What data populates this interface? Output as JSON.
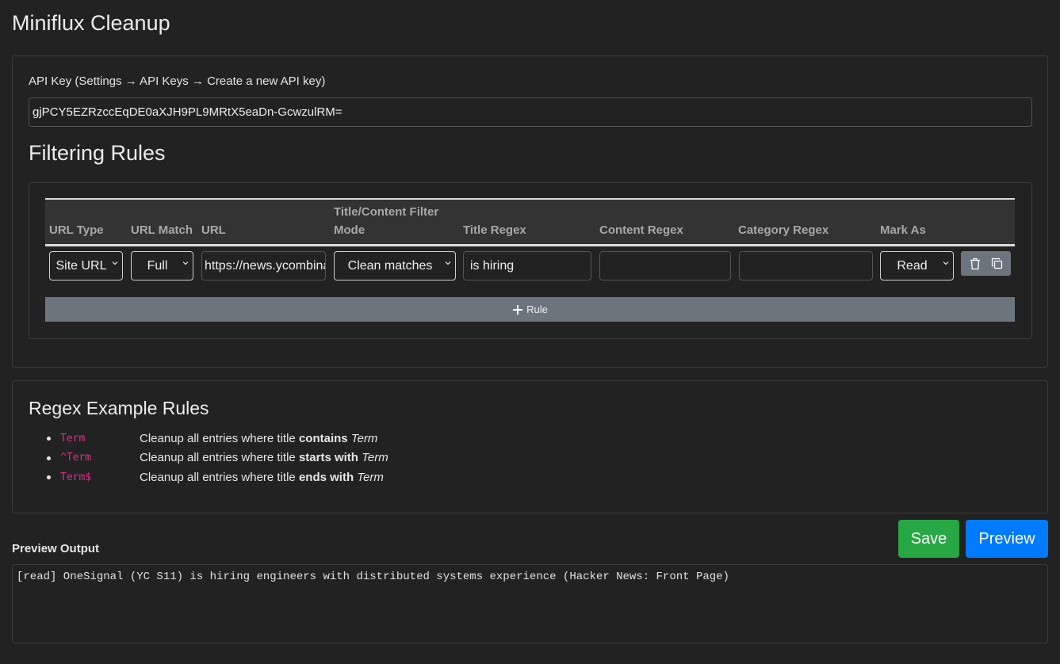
{
  "page": {
    "title": "Miniflux Cleanup"
  },
  "api": {
    "label": "API Key (Settings → API Keys → Create a new API key)",
    "value": "gjPCY5EZRzccEqDE0aXJH9PL9MRtX5eaDn-GcwzulRM="
  },
  "rules": {
    "title": "Filtering Rules",
    "headers": {
      "url_type": "URL Type",
      "url_match": "URL Match",
      "url": "URL",
      "mode_line1": "Title/Content Filter",
      "mode_line2": "Mode",
      "title_regex": "Title Regex",
      "content_regex": "Content Regex",
      "category_regex": "Category Regex",
      "mark_as": "Mark As"
    },
    "rows": [
      {
        "url_type": "Site URL",
        "url_match": "Full",
        "url": "https://news.ycombinator.com",
        "mode": "Clean matches",
        "title_regex": "is hiring",
        "content_regex": "",
        "category_regex": "",
        "mark_as": "Read"
      }
    ],
    "add_rule_label": "Rule"
  },
  "regex_examples": {
    "title": "Regex Example Rules",
    "items": [
      {
        "code": "Term",
        "prefix": "Cleanup all entries where title ",
        "bold": "contains",
        "italic": "Term"
      },
      {
        "code": "^Term",
        "prefix": "Cleanup all entries where title ",
        "bold": "starts with",
        "italic": "Term"
      },
      {
        "code": "Term$",
        "prefix": "Cleanup all entries where title ",
        "bold": "ends with",
        "italic": "Term"
      }
    ]
  },
  "actions": {
    "save_label": "Save",
    "preview_label": "Preview"
  },
  "preview": {
    "label": "Preview Output",
    "output": "[read] OneSignal (YC S11) is hiring engineers with distributed systems experience (Hacker News: Front Page)"
  },
  "colors": {
    "background": "#222222",
    "save": "#28a745",
    "preview": "#007bff",
    "secondary": "#6c757d",
    "code": "#d63384"
  }
}
